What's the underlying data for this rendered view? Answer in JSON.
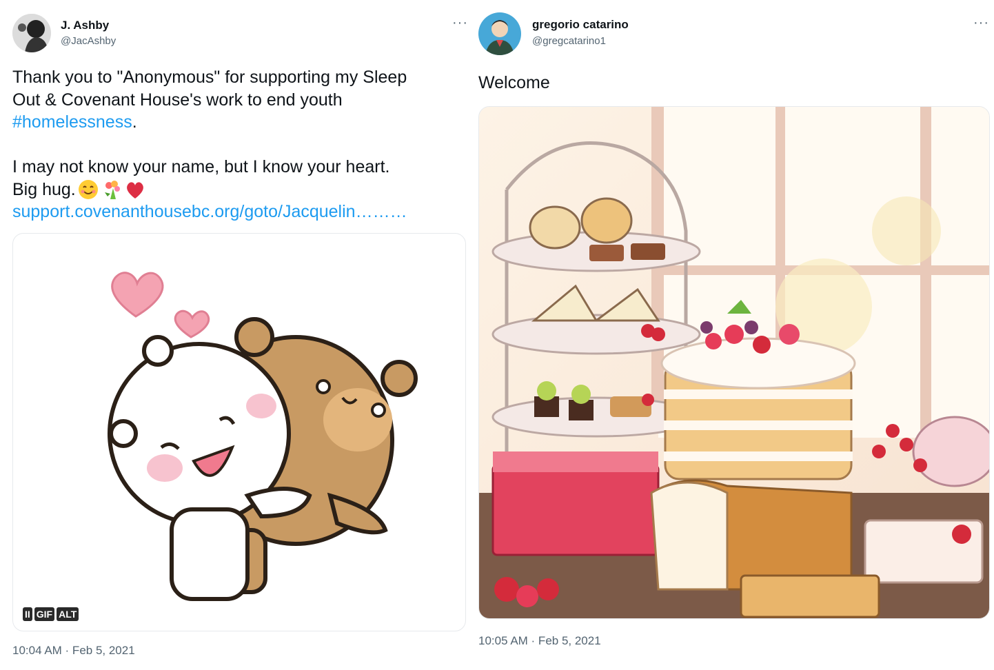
{
  "tweet1": {
    "display_name": "J. Ashby",
    "handle": "@JacAshby",
    "more_label": "···",
    "text_line1": "Thank you to \"Anonymous\" for supporting my Sleep",
    "text_line2": "Out & Covenant House's work to end youth",
    "hashtag": "#homelessness",
    "hashtag_tail": ".",
    "text_line4": "I may not know your name, but I know your heart.",
    "text_line5": "Big hug.",
    "emojis": [
      "smiling-face",
      "bouquet",
      "red-heart"
    ],
    "url": "support.covenanthousebc.org/goto/Jacquelin…",
    "url_tail": "……",
    "media_badges": {
      "pause": "II",
      "gif": "GIF",
      "alt": "ALT"
    },
    "timestamp": "10:04 AM · Feb 5, 2021"
  },
  "tweet2": {
    "display_name": "gregorio catarino",
    "handle": "@gregcatarino1",
    "more_label": "···",
    "text": "Welcome",
    "timestamp": "10:05 AM · Feb 5, 2021"
  }
}
